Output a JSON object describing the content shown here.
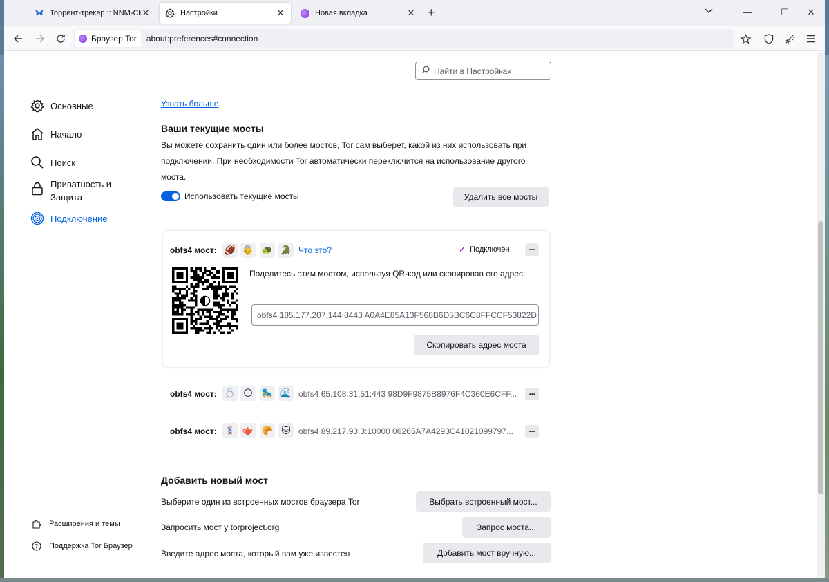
{
  "tabs": [
    {
      "label": "Торрент-трекер :: NNM-Club"
    },
    {
      "label": "Настройки"
    },
    {
      "label": "Новая вкладка"
    }
  ],
  "identity_label": "Браузер Tor",
  "url": "about:preferences#connection",
  "search_placeholder": "Найти в Настройках",
  "sidebar": {
    "items": [
      {
        "label": "Основные"
      },
      {
        "label": "Начало"
      },
      {
        "label": "Поиск"
      },
      {
        "label": "Приватность и Защита"
      },
      {
        "label": "Подключение"
      }
    ],
    "footer": [
      {
        "label": "Расширения и темы"
      },
      {
        "label": "Поддержка Tor Браузер"
      }
    ]
  },
  "main": {
    "learn_more": "Узнать больше",
    "current_bridges_title": "Ваши текущие мосты",
    "current_bridges_desc": "Вы можете сохранить один или более мостов, Tor сам выберет, какой из них использовать при подключении. При необходимости Tor автоматически переключится на использование другого моста.",
    "use_current_label": "Использовать текущие мосты",
    "remove_all_label": "Удалить все мосты",
    "bridge_card": {
      "label": "obfs4 мост:",
      "emojis": [
        "🏈",
        "👵",
        "🐢",
        "🐊"
      ],
      "what_is_this": "Что это?",
      "status": "Подключён",
      "share_text": "Поделитесь этим мостом, используя QR-код или скопировав его адрес:",
      "address": "obfs4 185.177.207.144:8443 A0A4E85A13F568B6D5BC6C8FFCCF53822D",
      "copy_label": "Скопировать адрес моста"
    },
    "bridges": [
      {
        "label": "obfs4 мост:",
        "emojis": [
          "💍",
          "🌕",
          "🛼",
          "🌊"
        ],
        "address": "obfs4 65.108.31.51:443 98D9F9875B8976F4C360E6CFF..."
      },
      {
        "label": "obfs4 мост:",
        "emojis": [
          "💈",
          "🫖",
          "🥐",
          "🐱"
        ],
        "address": "obfs4 89.217.93.3:10000 06265A7A4293C41021099797..."
      }
    ],
    "add_bridge_title": "Добавить новый мост",
    "add_rows": [
      {
        "text": "Выберите один из встроенных мостов браузера Tor",
        "button": "Выбрать встроенный мост..."
      },
      {
        "text": "Запросить мост у torproject.org",
        "button": "Запрос моста..."
      },
      {
        "text": "Введите адрес моста, который вам уже известен",
        "button": "Добавить мост вручную..."
      }
    ]
  },
  "colors": {
    "accent": "#0061e0",
    "tor_purple": "#8000d7",
    "button_bg": "#e9e9ed"
  }
}
